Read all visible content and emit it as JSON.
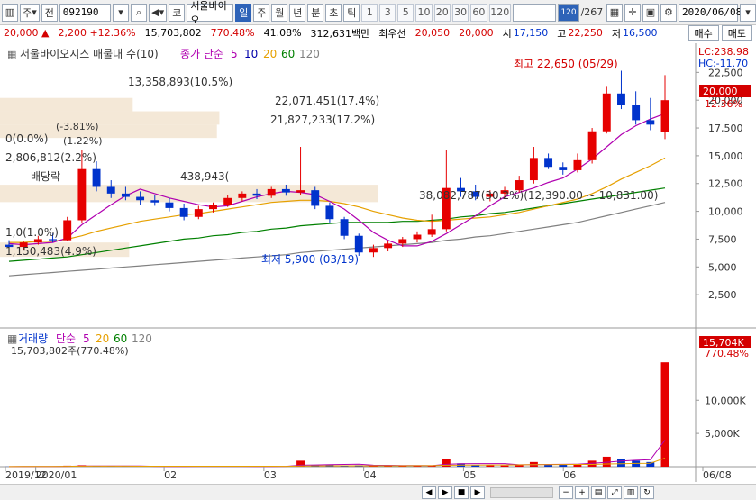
{
  "toolbar": {
    "mode_label": "주",
    "prev_label": "전",
    "code_value": "092190",
    "market_label": "코",
    "stock_name": "서울바이오",
    "periods": [
      "일",
      "주",
      "월",
      "년",
      "분",
      "초",
      "틱"
    ],
    "active_period": "일",
    "ticks": [
      "1",
      "3",
      "5",
      "10",
      "20",
      "30",
      "60",
      "120"
    ],
    "count_value": "120",
    "total_label": "/267",
    "date_value": "2020/06/08"
  },
  "quote": {
    "price": "20,000",
    "change": "2,200",
    "change_pct": "+12.36%",
    "volume": "15,703,802",
    "vol_ratio": "770.48%",
    "turnover": "41.08%",
    "amount": "312,631백만",
    "best_ask_label": "최우선",
    "best_ask": "20,050",
    "best_bid": "20,000",
    "open_label": "시",
    "open": "17,150",
    "high_label": "고",
    "high": "22,250",
    "low_label": "저",
    "low": "16,500",
    "buy_label": "매수",
    "sell_label": "매도"
  },
  "legend": {
    "title": "서울바이오시스 매물대 수(10)",
    "ma_label": "종가 단순",
    "ma5": "5",
    "ma10": "10",
    "ma20": "20",
    "ma60": "60",
    "ma120": "120",
    "lc_label": "LC:238.98",
    "hc_label": "HC:-11.70"
  },
  "annotations": {
    "high_text": "최고 22,650 (05/29)",
    "low_text": "최저 5,900 (03/19)",
    "vp1": "13,358,893(10.5%)",
    "vp2": "22,071,451(17.4%)",
    "vp3": "21,827,233(17.2%)",
    "vp4": "38,082,787(30.2%)(12,390.00 ~ 10,831.00)",
    "vp5": "0(0.0%)",
    "vp6": "2,806,812(2.2%)",
    "vp7": "1,150,483(4.9%)",
    "vp8": "(-3.81%)",
    "vp9": "(1.22%)",
    "div_label": "배당락",
    "vp10": "438,943(",
    "vp11": "1,0(1.0%)",
    "price_tag": "20,000",
    "pct_tag": "12.36%"
  },
  "volume_panel": {
    "legend_title": "거래량",
    "ma_label": "단순",
    "ma5": "5",
    "ma20": "20",
    "ma60": "60",
    "ma120": "120",
    "vol_text": "15,703,802주(770.48%)",
    "vol_tag": "15,704K",
    "vol_pct_tag": "770.48%"
  },
  "colors": {
    "up": "#e60000",
    "down": "#0033cc",
    "ma5": "#b000b0",
    "ma10": "#0000aa",
    "ma20": "#e6a000",
    "ma60": "#008000",
    "ma120": "#808080"
  },
  "chart_data": {
    "type": "candlestick",
    "y_ticks": [
      "22,500",
      "20,000",
      "17,500",
      "15,000",
      "12,500",
      "10,000",
      "7,500",
      "5,000",
      "2,500"
    ],
    "vol_ticks": [
      "10,000K",
      "5,000K"
    ],
    "x_labels": [
      "2019/12",
      "2020/01",
      "02",
      "03",
      "04",
      "05",
      "06",
      "06/08"
    ],
    "ylim": [
      0,
      22650
    ],
    "candles": [
      {
        "o": 7000,
        "h": 7400,
        "l": 6600,
        "c": 6800
      },
      {
        "o": 6800,
        "h": 7300,
        "l": 6500,
        "c": 7200
      },
      {
        "o": 7200,
        "h": 7800,
        "l": 7000,
        "c": 7500
      },
      {
        "o": 7500,
        "h": 8000,
        "l": 7200,
        "c": 7400
      },
      {
        "o": 7400,
        "h": 9500,
        "l": 7300,
        "c": 9200
      },
      {
        "o": 9200,
        "h": 15500,
        "l": 9000,
        "c": 13800
      },
      {
        "o": 13800,
        "h": 14500,
        "l": 11800,
        "c": 12200
      },
      {
        "o": 12200,
        "h": 12800,
        "l": 11200,
        "c": 11600
      },
      {
        "o": 11600,
        "h": 12200,
        "l": 11000,
        "c": 11300
      },
      {
        "o": 11300,
        "h": 11800,
        "l": 10600,
        "c": 11000
      },
      {
        "o": 11000,
        "h": 11500,
        "l": 10500,
        "c": 10800
      },
      {
        "o": 10800,
        "h": 11200,
        "l": 10000,
        "c": 10300
      },
      {
        "o": 10300,
        "h": 10700,
        "l": 9200,
        "c": 9500
      },
      {
        "o": 9500,
        "h": 10500,
        "l": 9300,
        "c": 10200
      },
      {
        "o": 10200,
        "h": 10800,
        "l": 9900,
        "c": 10600
      },
      {
        "o": 10600,
        "h": 11500,
        "l": 10400,
        "c": 11200
      },
      {
        "o": 11200,
        "h": 11800,
        "l": 10900,
        "c": 11600
      },
      {
        "o": 11600,
        "h": 12000,
        "l": 11100,
        "c": 11400
      },
      {
        "o": 11400,
        "h": 12200,
        "l": 11200,
        "c": 12000
      },
      {
        "o": 12000,
        "h": 12400,
        "l": 11400,
        "c": 11700
      },
      {
        "o": 11700,
        "h": 15800,
        "l": 11500,
        "c": 11900
      },
      {
        "o": 11900,
        "h": 12200,
        "l": 10200,
        "c": 10500
      },
      {
        "o": 10500,
        "h": 10800,
        "l": 9000,
        "c": 9300
      },
      {
        "o": 9300,
        "h": 9500,
        "l": 7500,
        "c": 7800
      },
      {
        "o": 7800,
        "h": 8000,
        "l": 6000,
        "c": 6300
      },
      {
        "o": 6300,
        "h": 7000,
        "l": 5900,
        "c": 6700
      },
      {
        "o": 6700,
        "h": 7300,
        "l": 6400,
        "c": 7100
      },
      {
        "o": 7100,
        "h": 7700,
        "l": 6800,
        "c": 7500
      },
      {
        "o": 7500,
        "h": 8200,
        "l": 7200,
        "c": 7900
      },
      {
        "o": 7900,
        "h": 9700,
        "l": 7700,
        "c": 8400
      },
      {
        "o": 8400,
        "h": 15500,
        "l": 8200,
        "c": 12100
      },
      {
        "o": 12100,
        "h": 13000,
        "l": 11300,
        "c": 11800
      },
      {
        "o": 11800,
        "h": 12400,
        "l": 11000,
        "c": 11300
      },
      {
        "o": 11300,
        "h": 11900,
        "l": 10900,
        "c": 11600
      },
      {
        "o": 11600,
        "h": 12200,
        "l": 11200,
        "c": 11900
      },
      {
        "o": 11900,
        "h": 13200,
        "l": 11700,
        "c": 12800
      },
      {
        "o": 12800,
        "h": 15800,
        "l": 12500,
        "c": 14800
      },
      {
        "o": 14800,
        "h": 15200,
        "l": 13800,
        "c": 14000
      },
      {
        "o": 14000,
        "h": 14400,
        "l": 13300,
        "c": 13700
      },
      {
        "o": 13700,
        "h": 15200,
        "l": 13500,
        "c": 14600
      },
      {
        "o": 14600,
        "h": 17500,
        "l": 14300,
        "c": 17200
      },
      {
        "o": 17200,
        "h": 21200,
        "l": 17000,
        "c": 20600
      },
      {
        "o": 20600,
        "h": 22650,
        "l": 19200,
        "c": 19600
      },
      {
        "o": 19600,
        "h": 20800,
        "l": 17800,
        "c": 18200
      },
      {
        "o": 18200,
        "h": 20200,
        "l": 17300,
        "c": 17800
      },
      {
        "o": 17150,
        "h": 22250,
        "l": 16500,
        "c": 20000
      }
    ],
    "volumes": [
      20,
      25,
      30,
      40,
      150,
      220,
      90,
      60,
      50,
      40,
      35,
      40,
      70,
      60,
      40,
      50,
      45,
      35,
      60,
      50,
      900,
      250,
      300,
      180,
      220,
      160,
      140,
      120,
      150,
      180,
      1200,
      500,
      250,
      200,
      180,
      260,
      700,
      350,
      280,
      300,
      900,
      1500,
      1200,
      900,
      700,
      15704
    ],
    "ma5": [
      7100,
      7000,
      7100,
      7200,
      7600,
      8800,
      9700,
      10600,
      11400,
      12000,
      11600,
      11200,
      10900,
      10600,
      10400,
      10500,
      10900,
      11300,
      11600,
      11800,
      11700,
      11500,
      10900,
      10200,
      9200,
      8100,
      7400,
      6900,
      6900,
      7300,
      8000,
      8800,
      9600,
      10500,
      11300,
      11700,
      12100,
      12600,
      13000,
      13800,
      14700,
      15800,
      16900,
      17700,
      18300,
      18800
    ],
    "ma20": [
      7200,
      7200,
      7300,
      7300,
      7500,
      7800,
      8200,
      8500,
      8800,
      9100,
      9300,
      9500,
      9700,
      9800,
      10000,
      10200,
      10400,
      10600,
      10800,
      10900,
      11000,
      11000,
      10900,
      10700,
      10400,
      10000,
      9700,
      9400,
      9200,
      9100,
      9200,
      9300,
      9400,
      9500,
      9700,
      9900,
      10200,
      10500,
      10800,
      11100,
      11600,
      12200,
      12900,
      13500,
      14100,
      14800
    ],
    "ma60": [
      5500,
      5600,
      5700,
      5800,
      5900,
      6100,
      6300,
      6500,
      6700,
      6900,
      7100,
      7300,
      7500,
      7600,
      7800,
      7900,
      8100,
      8200,
      8400,
      8500,
      8700,
      8800,
      8900,
      9000,
      9000,
      9000,
      9000,
      9100,
      9100,
      9200,
      9300,
      9500,
      9600,
      9800,
      9900,
      10100,
      10300,
      10500,
      10700,
      10900,
      11100,
      11300,
      11500,
      11700,
      11900,
      12100
    ],
    "ma120": [
      4200,
      4300,
      4400,
      4500,
      4600,
      4700,
      4800,
      4900,
      5000,
      5100,
      5200,
      5300,
      5400,
      5500,
      5600,
      5700,
      5800,
      5900,
      6000,
      6100,
      6300,
      6400,
      6500,
      6600,
      6700,
      6800,
      6900,
      7000,
      7100,
      7200,
      7400,
      7500,
      7700,
      7800,
      8000,
      8200,
      8400,
      8600,
      8800,
      9000,
      9300,
      9600,
      9900,
      10200,
      10500,
      10800
    ]
  }
}
